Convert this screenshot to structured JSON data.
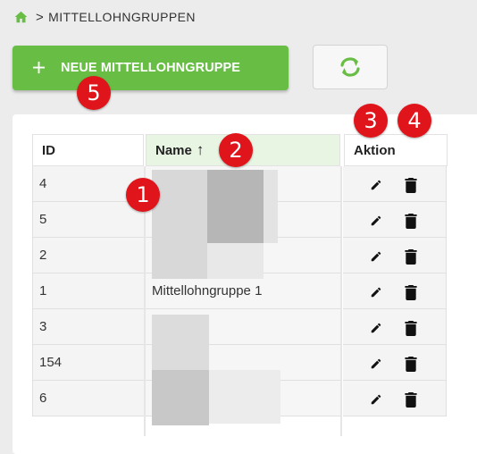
{
  "breadcrumb": {
    "icon": "home-icon",
    "separator": ">",
    "label": "MITTELLOHNGRUPPEN"
  },
  "toolbar": {
    "add_label": "NEUE MITTELLOHNGRUPPE",
    "add_icon": "plus-icon",
    "refresh_icon": "refresh-icon"
  },
  "table": {
    "columns": [
      {
        "label": "ID"
      },
      {
        "label": "Name",
        "sort_indicator": "↑"
      },
      {
        "label": "Aktion"
      }
    ],
    "rows": [
      {
        "id": "4",
        "name": ""
      },
      {
        "id": "5",
        "name": ""
      },
      {
        "id": "2",
        "name": ""
      },
      {
        "id": "1",
        "name": "Mittellohngruppe 1"
      },
      {
        "id": "3",
        "name": ""
      },
      {
        "id": "154",
        "name": ""
      },
      {
        "id": "6",
        "name": ""
      }
    ],
    "edit_icon": "pencil-icon",
    "delete_icon": "trash-icon"
  },
  "markers": [
    "1",
    "2",
    "3",
    "4",
    "5"
  ],
  "colors": {
    "primary": "#68bd45",
    "marker": "#e0141b",
    "sorted_header": "#e9f5e3"
  }
}
